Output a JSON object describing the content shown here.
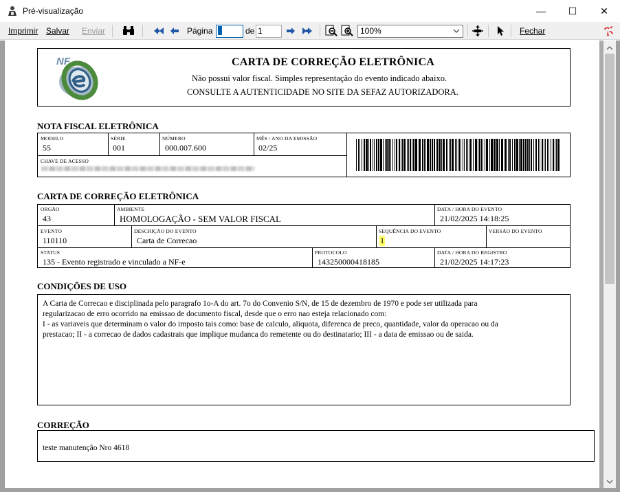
{
  "window": {
    "title": "Pré-visualização",
    "minimize_glyph": "—",
    "maximize_glyph": "☐",
    "close_glyph": "✕"
  },
  "toolbar": {
    "print_label": "Imprimir",
    "save_label": "Salvar",
    "send_label": "Enviar",
    "page_label": "Página",
    "page_value": "1",
    "of_label": "de",
    "page_total": "1",
    "zoom_value": "100%",
    "close_label": "Fechar",
    "icons": [
      "binoculars-icon",
      "double-arrow-left-icon",
      "arrow-left-icon",
      "arrow-right-icon",
      "double-arrow-right-icon",
      "zoom-out-icon",
      "zoom-in-icon",
      "pan-icon",
      "pointer-icon",
      "app-logo-icon"
    ]
  },
  "document": {
    "header": {
      "title": "CARTA DE CORREÇÃO ELETRÔNICA",
      "subtitle1": "Não possui valor fiscal. Simples representação do evento indicado abaixo.",
      "subtitle2": "CONSULTE A AUTENTICIDADE NO SITE DA SEFAZ AUTORIZADORA.",
      "logo_text": "NF"
    },
    "nfe": {
      "section_title": "NOTA FISCAL ELETRÔNICA",
      "modelo_label": "Modelo",
      "modelo": "55",
      "serie_label": "Série",
      "serie": "001",
      "numero_label": "Número",
      "numero": "000.007.600",
      "mes_ano_label": "Mês / Ano da emissão",
      "mes_ano": "02/25",
      "chave_label": "Chave de acesso"
    },
    "cce": {
      "section_title": "CARTA DE CORREÇÃO ELETRÔNICA",
      "orgao_label": "Orgão",
      "orgao": "43",
      "ambiente_label": "Ambiente",
      "ambiente": "HOMOLOGAÇÃO - SEM VALOR FISCAL",
      "data_evento_label": "Data / Hora do evento",
      "data_evento": "21/02/2025 14:18:25",
      "evento_label": "Evento",
      "evento": "110110",
      "descricao_label": "Descrição do evento",
      "descricao": "Carta de Correcao",
      "sequencia_label": "Sequência do evento",
      "sequencia": "1",
      "versao_label": "Versão do evento",
      "versao": "",
      "status_label": "Status",
      "status": "135 - Evento registrado e vinculado a NF-e",
      "protocolo_label": "Protocolo",
      "protocolo": "143250000418185",
      "data_registro_label": "Data / Hora do registro",
      "data_registro": "21/02/2025 14:17:23"
    },
    "condicoes": {
      "section_title": "CONDIÇÕES DE USO",
      "line1": "A Carta de Correcao e disciplinada pelo paragrafo 1o-A do art. 7o do Convenio S/N, de 15 de dezembro de 1970 e pode ser utilizada para",
      "line2": "regularizacao de erro ocorrido na emissao de documento fiscal, desde que o erro nao esteja relacionado com:",
      "line3": "I - as variaveis que determinam o valor do imposto tais como: base de calculo, aliquota, diferenca de preco, quantidade, valor da operacao ou da",
      "line4": "prestacao; II - a correcao de dados cadastrais que implique mudanca do remetente ou do destinatario; III - a data de emissao ou de saida."
    },
    "correcao": {
      "section_title": "CORREÇÃO",
      "text": "teste manutenção Nro 4618"
    }
  }
}
